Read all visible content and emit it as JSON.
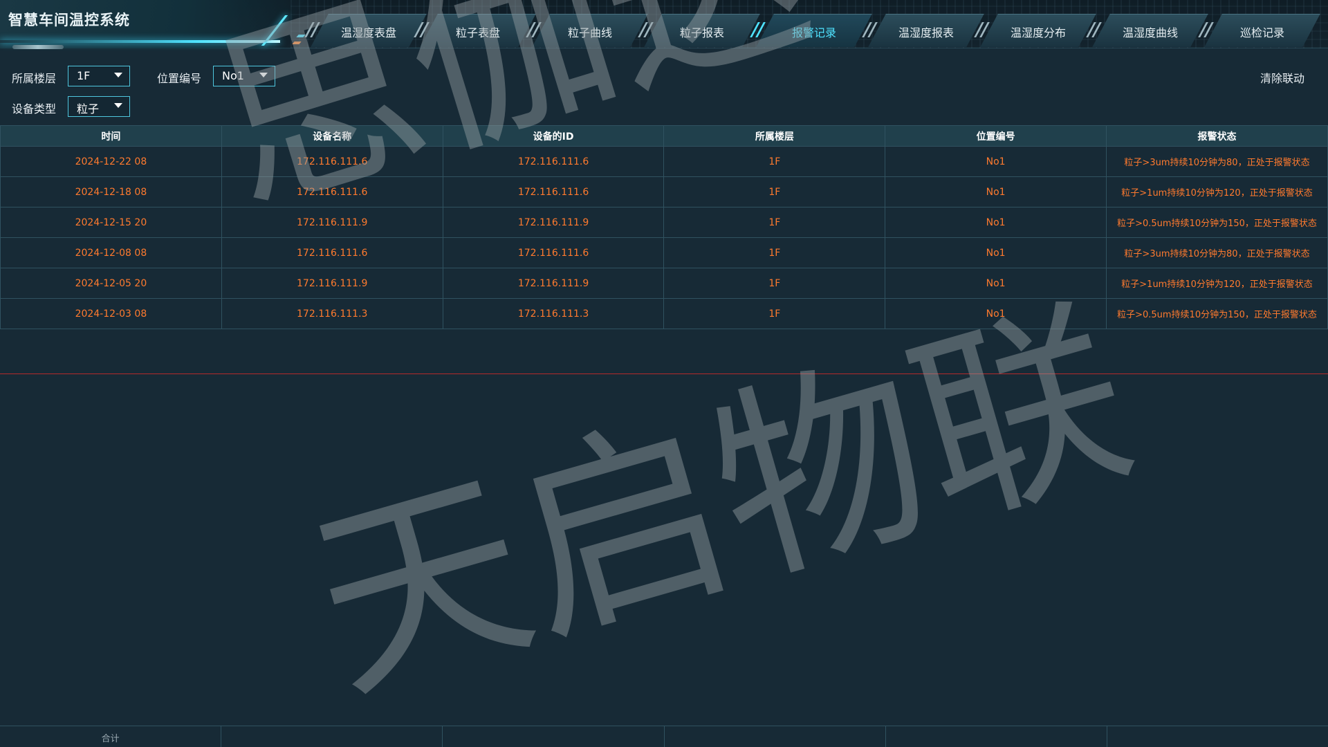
{
  "app": {
    "title": "智慧车间温控系统"
  },
  "nav": {
    "tabs": [
      {
        "label": "温湿度表盘",
        "active": false
      },
      {
        "label": "粒子表盘",
        "active": false
      },
      {
        "label": "粒子曲线",
        "active": false
      },
      {
        "label": "粒子报表",
        "active": false
      },
      {
        "label": "报警记录",
        "active": true
      },
      {
        "label": "温湿度报表",
        "active": false
      },
      {
        "label": "温湿度分布",
        "active": false
      },
      {
        "label": "温湿度曲线",
        "active": false
      },
      {
        "label": "巡检记录",
        "active": false
      }
    ]
  },
  "filters": {
    "floor_label": "所属楼层",
    "floor_value": "1F",
    "position_label": "位置编号",
    "position_value": "No1",
    "device_type_label": "设备类型",
    "device_type_value": "粒子",
    "clear_label": "清除联动"
  },
  "table": {
    "headers": [
      "时间",
      "设备名称",
      "设备的ID",
      "所属楼层",
      "位置编号",
      "报警状态"
    ],
    "rows": [
      [
        "2024-12-22 08",
        "172.116.111.6",
        "172.116.111.6",
        "1F",
        "No1",
        "粒子>3um持续10分钟为80，正处于报警状态"
      ],
      [
        "2024-12-18 08",
        "172.116.111.6",
        "172.116.111.6",
        "1F",
        "No1",
        "粒子>1um持续10分钟为120，正处于报警状态"
      ],
      [
        "2024-12-15 20",
        "172.116.111.9",
        "172.116.111.9",
        "1F",
        "No1",
        "粒子>0.5um持续10分钟为150，正处于报警状态"
      ],
      [
        "2024-12-08 08",
        "172.116.111.6",
        "172.116.111.6",
        "1F",
        "No1",
        "粒子>3um持续10分钟为80，正处于报警状态"
      ],
      [
        "2024-12-05 20",
        "172.116.111.9",
        "172.116.111.9",
        "1F",
        "No1",
        "粒子>1um持续10分钟为120，正处于报警状态"
      ],
      [
        "2024-12-03 08",
        "172.116.111.3",
        "172.116.111.3",
        "1F",
        "No1",
        "粒子>0.5um持续10分钟为150，正处于报警状态"
      ]
    ],
    "footer_label": "合计"
  },
  "watermark": {
    "top": "思伽达",
    "bottom": "天启物联"
  },
  "colors": {
    "background": "#172a36",
    "accent": "#4fe3ff",
    "alarm_text": "#ff7a2e",
    "divider_line": "#b52a2a"
  }
}
